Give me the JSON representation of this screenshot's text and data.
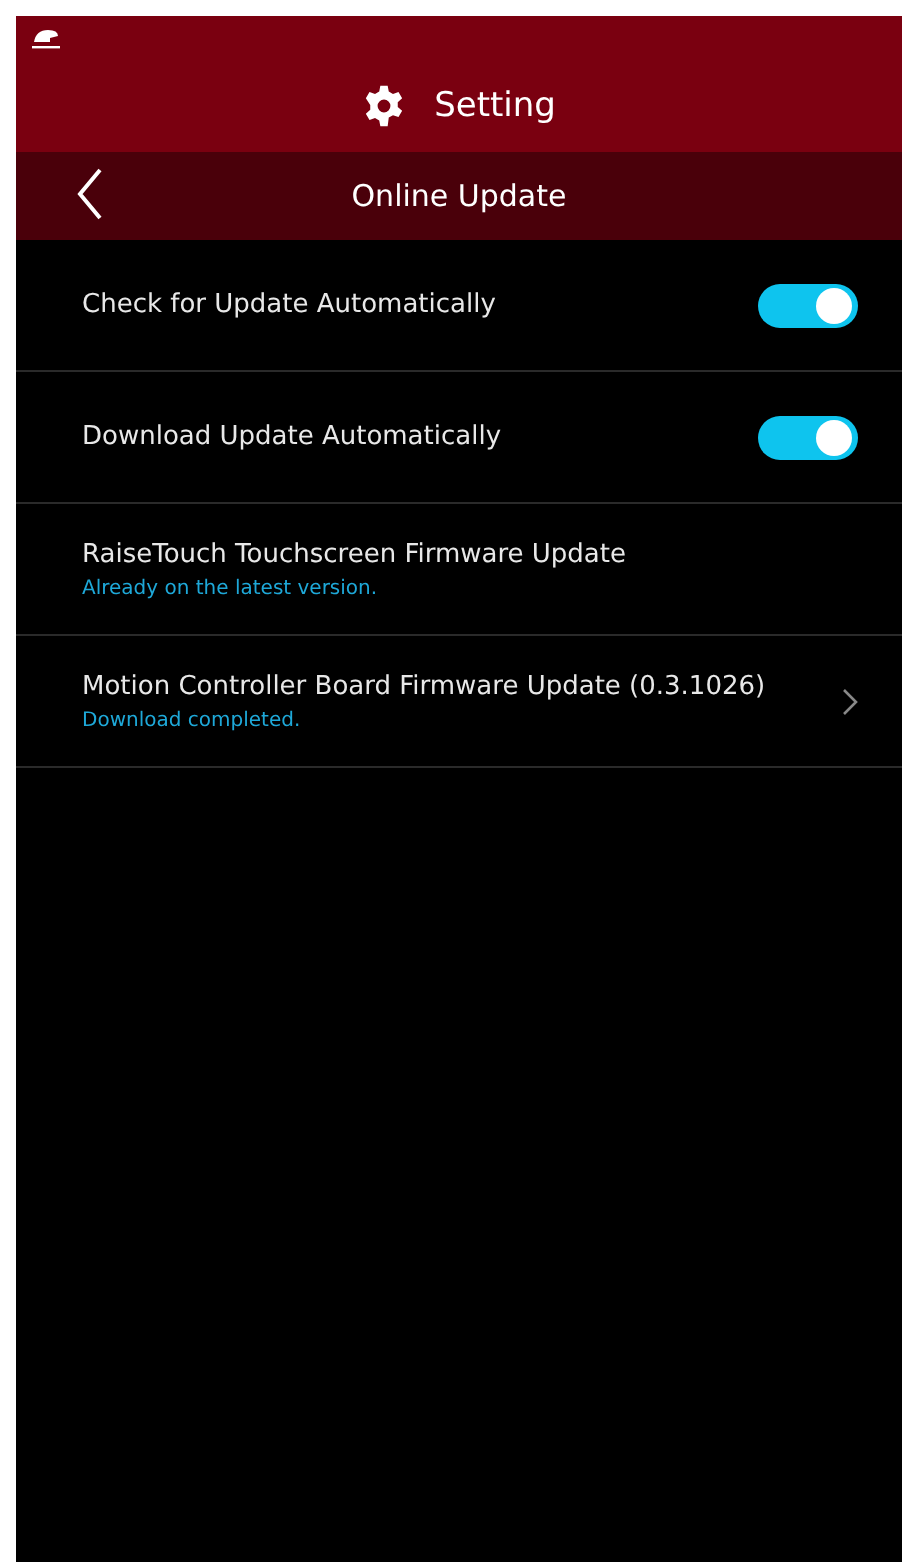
{
  "header": {
    "title": "Setting"
  },
  "subheader": {
    "title": "Online Update"
  },
  "items": [
    {
      "kind": "toggle",
      "label": "Check for Update Automatically",
      "on": true
    },
    {
      "kind": "toggle",
      "label": "Download Update Automatically",
      "on": true
    },
    {
      "kind": "info",
      "label": "RaiseTouch Touchscreen Firmware Update",
      "status": "Already on the latest version."
    },
    {
      "kind": "link",
      "label": "Motion Controller Board Firmware Update (0.3.1026)",
      "status": "Download completed."
    }
  ]
}
